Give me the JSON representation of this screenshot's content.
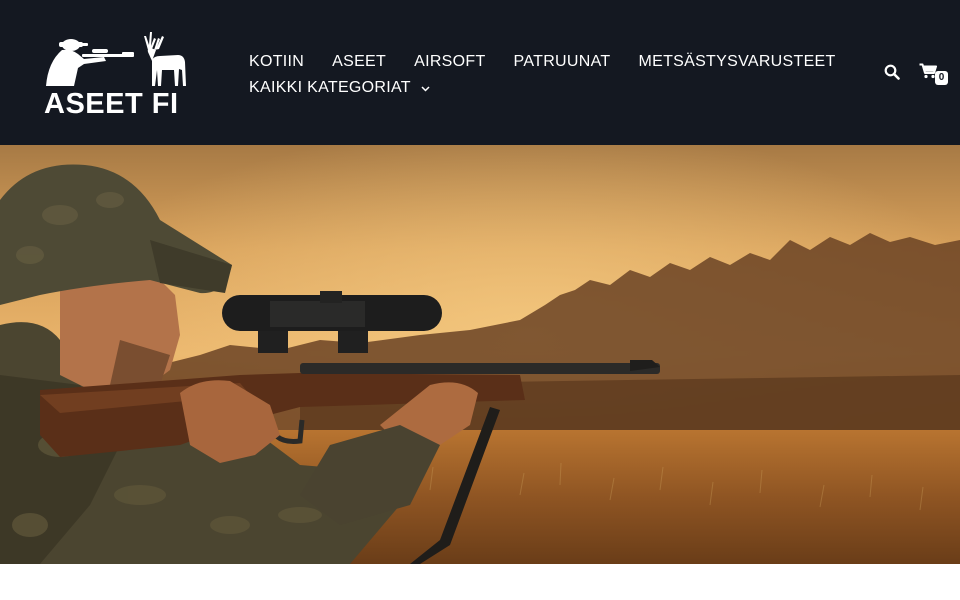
{
  "brand": {
    "name": "ASEET FI",
    "logo_icon": "hunter-deer-logo"
  },
  "nav": {
    "row1": [
      {
        "label": "KOTIIN"
      },
      {
        "label": "ASEET"
      },
      {
        "label": "AIRSOFT"
      },
      {
        "label": "PATRUUNAT"
      },
      {
        "label": "METSÄSTYSVARUSTEET"
      }
    ],
    "row2": [
      {
        "label": "KAIKKI KATEGORIAT",
        "icon": "chevron-down-icon"
      }
    ]
  },
  "actions": {
    "search_icon": "search-icon",
    "cart_icon": "cart-icon",
    "cart_count": "0"
  },
  "hero": {
    "image": "hunter-aiming-rifle-at-sunset-field"
  },
  "colors": {
    "header_bg": "#141821",
    "text": "#ffffff"
  }
}
